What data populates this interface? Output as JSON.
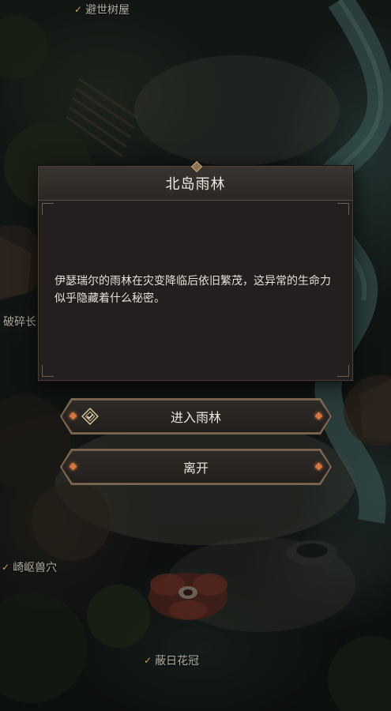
{
  "map": {
    "locations": [
      {
        "name": "避世树屋",
        "checked": true
      },
      {
        "name": "破碎长",
        "checked": false
      },
      {
        "name": "崎岖兽穴",
        "checked": true
      },
      {
        "name": "蔽日花冠",
        "checked": true
      }
    ]
  },
  "dialog": {
    "title": "北岛雨林",
    "body": "伊瑟瑞尔的雨林在灾变降临后依旧繁茂，这异常的生命力似乎隐藏着什么秘密。"
  },
  "buttons": {
    "enter_label": "进入雨林",
    "leave_label": "离开"
  },
  "colors": {
    "accent_gold": "#c9a35a",
    "accent_orange": "#d5773e",
    "panel_bg": "#221f1e",
    "frame": "#6d5a47"
  },
  "icons": {
    "check": "check-icon",
    "enter": "enter-diamond-icon",
    "button_end": "orange-diamond-icon"
  }
}
